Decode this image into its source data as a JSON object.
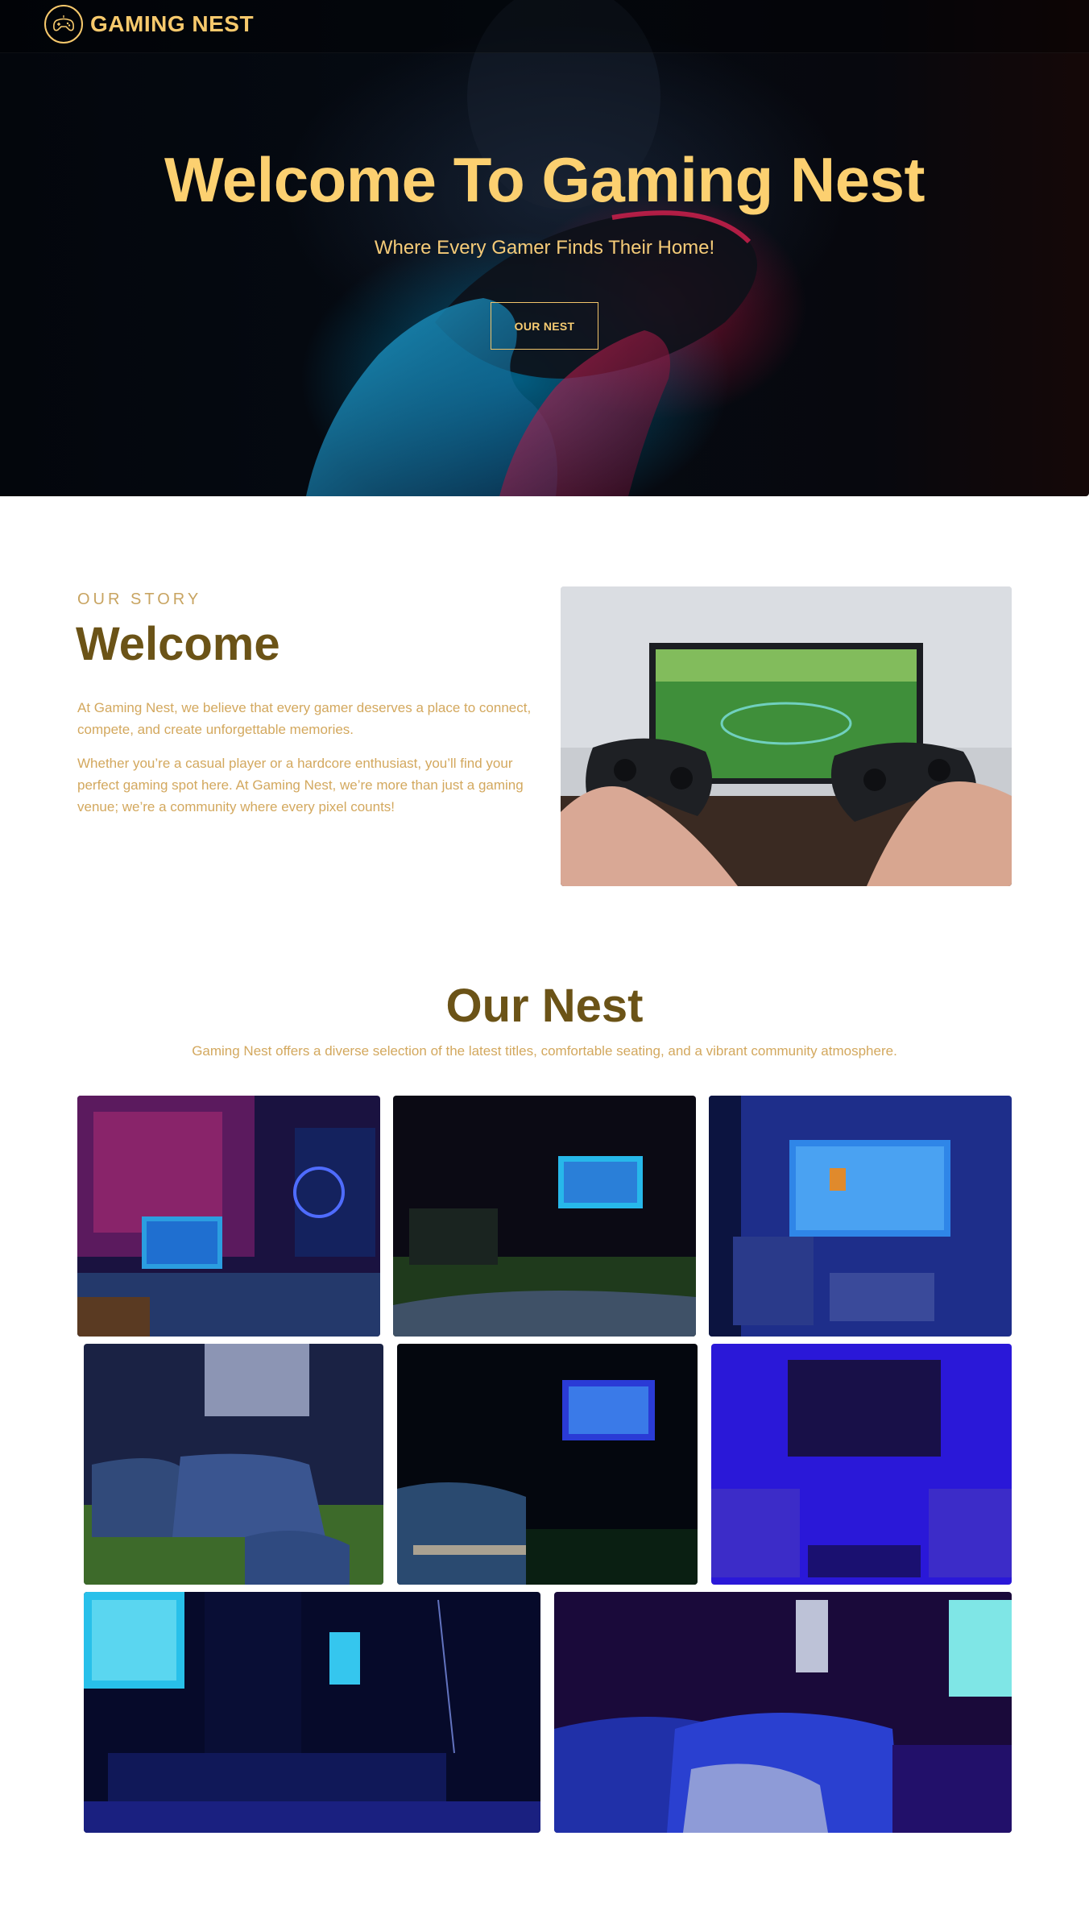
{
  "nav": {
    "brand": "GAMING NEST",
    "logo_icon": "gamepad-icon"
  },
  "hero": {
    "title": "Welcome To Gaming Nest",
    "subtitle": "Where Every Gamer Finds Their Home!",
    "button_label": "OUR NEST",
    "background": "hands-holding-controller-photo"
  },
  "story": {
    "eyebrow": "OUR STORY",
    "heading": "Welcome",
    "paragraphs": [
      "At Gaming Nest, we believe that every gamer deserves a place to connect, compete, and create unforgettable memories.",
      "Whether you’re a casual player or a hardcore enthusiast, you’ll find your perfect gaming spot here. At Gaming Nest, we’re more than just a gaming venue; we’re a community where every pixel counts!"
    ],
    "photo": "controllers-in-front-of-tv-photo"
  },
  "nest": {
    "heading": "Our Nest",
    "description": "Gaming Nest offers a diverse selection of the latest titles, comfortable seating, and a vibrant community atmosphere.",
    "gallery": [
      "neon-gaming-room-photo",
      "dark-room-tv-grass-photo",
      "blue-room-tv-armchair-photo",
      "lounge-sofas-grass-photo",
      "blue-sofa-tv-photo",
      "purple-lit-room-photo",
      "multi-screen-room-photo",
      "blue-lounge-seats-photo"
    ]
  },
  "colors": {
    "gold": "#fcd070",
    "brown": "#6b5317",
    "tan": "#d3a85e",
    "eyebrow": "#c8a461"
  }
}
